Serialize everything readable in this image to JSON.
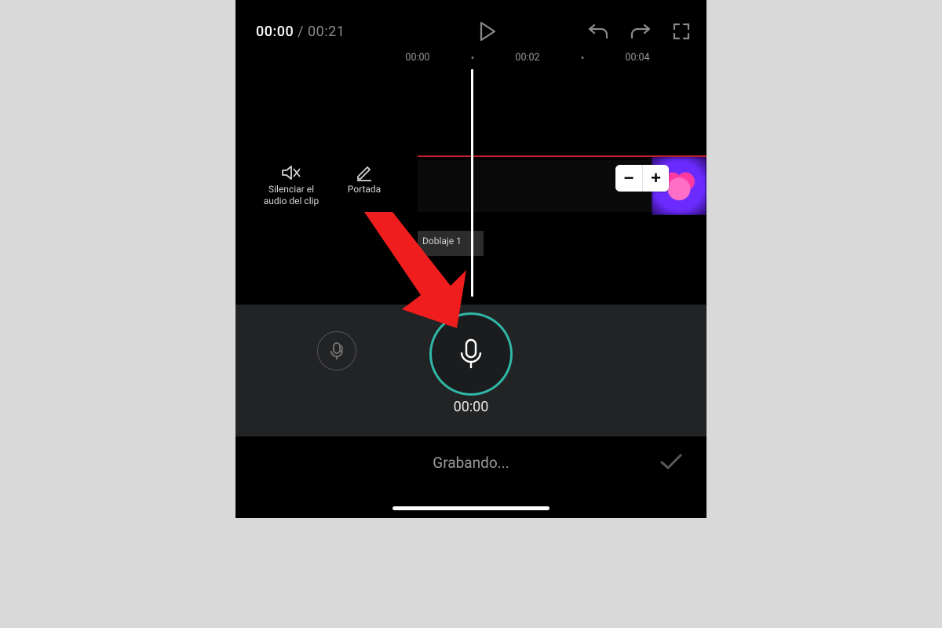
{
  "player": {
    "current_time": "00:00",
    "separator": " / ",
    "total_time": "00:21"
  },
  "ruler": {
    "marks": [
      "00:00",
      "00:02",
      "00:04"
    ]
  },
  "timeline": {
    "mute_label": "Silenciar el audio del clip",
    "cover_label": "Portada",
    "audio_clip_label": "Doblaje 1",
    "zoom_out": "−",
    "zoom_in": "+"
  },
  "record": {
    "elapsed": "00:00",
    "status": "Grabando..."
  },
  "colors": {
    "accent": "#2fb7a8",
    "annotation": "#ef1d1d"
  }
}
